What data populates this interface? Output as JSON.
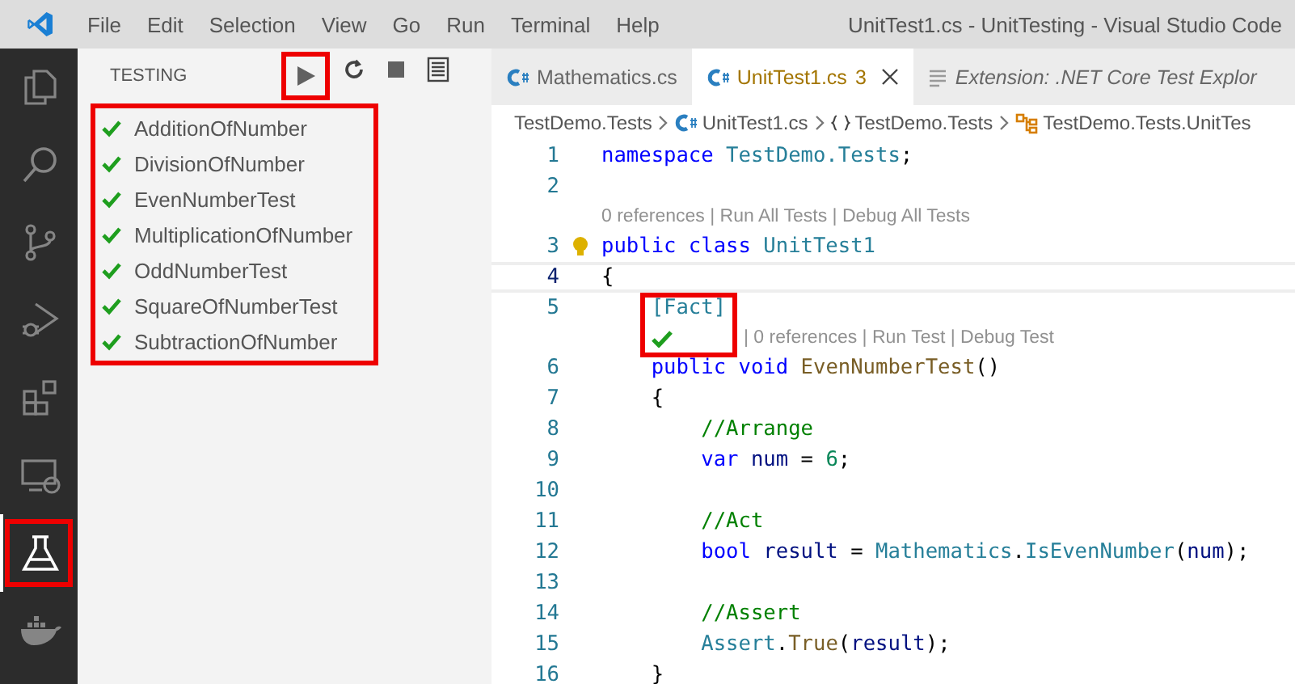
{
  "window": {
    "title": "UnitTest1.cs - UnitTesting - Visual Studio Code"
  },
  "menu": [
    "File",
    "Edit",
    "Selection",
    "View",
    "Go",
    "Run",
    "Terminal",
    "Help"
  ],
  "activity_bar": [
    {
      "kind": "files",
      "selected": false,
      "highlighted": false
    },
    {
      "kind": "search",
      "selected": false,
      "highlighted": false
    },
    {
      "kind": "source-control",
      "selected": false,
      "highlighted": false
    },
    {
      "kind": "run-debug",
      "selected": false,
      "highlighted": false
    },
    {
      "kind": "extensions",
      "selected": false,
      "highlighted": false
    },
    {
      "kind": "remote",
      "selected": false,
      "highlighted": false
    },
    {
      "kind": "testing",
      "selected": true,
      "highlighted": true
    },
    {
      "kind": "docker",
      "selected": false,
      "highlighted": false
    }
  ],
  "sidebar": {
    "title": "TESTING",
    "toolbar": [
      {
        "kind": "run",
        "highlighted": true
      },
      {
        "kind": "refresh",
        "highlighted": false
      },
      {
        "kind": "stop",
        "highlighted": false
      },
      {
        "kind": "log",
        "highlighted": false
      }
    ],
    "tests_highlighted": true,
    "tests": [
      {
        "name": "AdditionOfNumber",
        "passed": true
      },
      {
        "name": "DivisionOfNumber",
        "passed": true
      },
      {
        "name": "EvenNumberTest",
        "passed": true
      },
      {
        "name": "MultiplicationOfNumber",
        "passed": true
      },
      {
        "name": "OddNumberTest",
        "passed": true
      },
      {
        "name": "SquareOfNumberTest",
        "passed": true
      },
      {
        "name": "SubtractionOfNumber",
        "passed": true
      }
    ]
  },
  "tabs": [
    {
      "label": "Mathematics.cs",
      "kind": "csharp",
      "selected": false,
      "preview": false
    },
    {
      "label": "UnitTest1.cs",
      "kind": "csharp",
      "selected": true,
      "preview": false,
      "badge": "3"
    },
    {
      "label": "Extension: .NET Core Test Explor",
      "kind": "doc",
      "selected": false,
      "preview": true
    }
  ],
  "breadcrumb": [
    {
      "kind": "text",
      "label": "TestDemo.Tests"
    },
    {
      "kind": "csharp",
      "label": "UnitTest1.cs"
    },
    {
      "kind": "namespace",
      "label": "TestDemo.Tests"
    },
    {
      "kind": "class",
      "label": "TestDemo.Tests.UnitTes"
    }
  ],
  "code": [
    {
      "kind": "code",
      "line": "1",
      "current": false,
      "tokens": [
        {
          "t": "namespace",
          "kind": "kw"
        },
        {
          "t": " TestDemo.Tests",
          "kind": "type"
        },
        {
          "t": ";",
          "kind": "plain"
        }
      ]
    },
    {
      "kind": "code",
      "line": "2",
      "current": false
    },
    {
      "kind": "lens",
      "indented": false,
      "highlighted": false,
      "text": "0 references | Run All Tests | Debug All Tests"
    },
    {
      "kind": "code",
      "line": "3",
      "current": false,
      "bulb": true,
      "tokens": [
        {
          "t": "public class",
          "kind": "kw"
        },
        {
          "t": " UnitTest1",
          "kind": "type"
        }
      ]
    },
    {
      "kind": "code",
      "line": "4",
      "current": true,
      "tokens": [
        {
          "t": "{",
          "kind": "plain"
        }
      ]
    },
    {
      "kind": "code",
      "line": "5",
      "current": false,
      "tokens": [
        {
          "t": "    [Fact]",
          "kind": "type"
        }
      ]
    },
    {
      "kind": "lens",
      "indented": true,
      "passed": true,
      "highlighted": true,
      "text": "| 0 references | Run Test | Debug Test"
    },
    {
      "kind": "code",
      "line": "6",
      "current": false,
      "tokens": [
        {
          "t": "    public void",
          "kind": "kw"
        },
        {
          "t": " EvenNumberTest",
          "kind": "method"
        },
        {
          "t": "()",
          "kind": "plain"
        }
      ]
    },
    {
      "kind": "code",
      "line": "7",
      "current": false,
      "tokens": [
        {
          "t": "    {",
          "kind": "plain"
        }
      ]
    },
    {
      "kind": "code",
      "line": "8",
      "current": false,
      "tokens": [
        {
          "t": "        //Arrange",
          "kind": "comment"
        }
      ]
    },
    {
      "kind": "code",
      "line": "9",
      "current": false,
      "tokens": [
        {
          "t": "        var",
          "kind": "kw"
        },
        {
          "t": " num",
          "kind": "var"
        },
        {
          "t": " =",
          "kind": "plain"
        },
        {
          "t": " 6",
          "kind": "number"
        },
        {
          "t": ";",
          "kind": "plain"
        }
      ]
    },
    {
      "kind": "code",
      "line": "10",
      "current": false
    },
    {
      "kind": "code",
      "line": "11",
      "current": false,
      "tokens": [
        {
          "t": "        //Act",
          "kind": "comment"
        }
      ]
    },
    {
      "kind": "code",
      "line": "12",
      "current": false,
      "tokens": [
        {
          "t": "        bool",
          "kind": "kw"
        },
        {
          "t": " result",
          "kind": "var"
        },
        {
          "t": " =",
          "kind": "plain"
        },
        {
          "t": " Mathematics",
          "kind": "type"
        },
        {
          "t": ".",
          "kind": "plain"
        },
        {
          "t": "IsEvenNumber",
          "kind": "type"
        },
        {
          "t": "(",
          "kind": "plain"
        },
        {
          "t": "num",
          "kind": "var"
        },
        {
          "t": ");",
          "kind": "plain"
        }
      ]
    },
    {
      "kind": "code",
      "line": "13",
      "current": false
    },
    {
      "kind": "code",
      "line": "14",
      "current": false,
      "tokens": [
        {
          "t": "        //Assert",
          "kind": "comment"
        }
      ]
    },
    {
      "kind": "code",
      "line": "15",
      "current": false,
      "tokens": [
        {
          "t": "        Assert",
          "kind": "type"
        },
        {
          "t": ".",
          "kind": "plain"
        },
        {
          "t": "True",
          "kind": "method"
        },
        {
          "t": "(",
          "kind": "plain"
        },
        {
          "t": "result",
          "kind": "var"
        },
        {
          "t": ");",
          "kind": "plain"
        }
      ]
    },
    {
      "kind": "code",
      "line": "16",
      "current": false,
      "tokens": [
        {
          "t": "    }",
          "kind": "plain"
        }
      ]
    }
  ]
}
